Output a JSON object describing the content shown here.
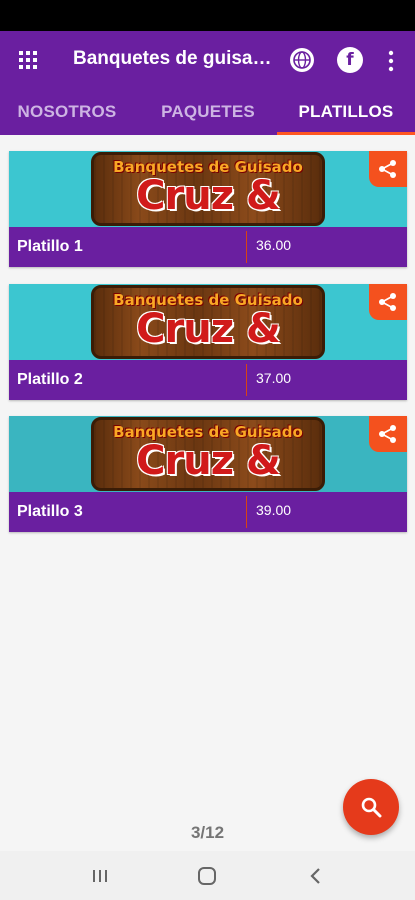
{
  "app_bar": {
    "title": "Banquetes de guisado Cruz & Gar",
    "icons": [
      "grid-icon",
      "globe-icon",
      "facebook-icon",
      "more-vert-icon"
    ],
    "facebook_glyph": "f"
  },
  "tabs": [
    {
      "label": "NOSOTROS",
      "active": false
    },
    {
      "label": "PAQUETES",
      "active": false
    },
    {
      "label": "PLATILLOS",
      "active": true
    }
  ],
  "banner_logo": {
    "small_text": "Banquetes de Guisado",
    "big_text": "Cruz & Gar"
  },
  "items": [
    {
      "name": "Platillo 1",
      "price": "36.00"
    },
    {
      "name": "Platillo 2",
      "price": "37.00"
    },
    {
      "name": "Platillo 3",
      "price": "39.00"
    }
  ],
  "pager": "3/12",
  "colors": {
    "primary": "#6a1fa0",
    "accent": "#f4511e",
    "banner_bg": "#3cc6d0"
  }
}
